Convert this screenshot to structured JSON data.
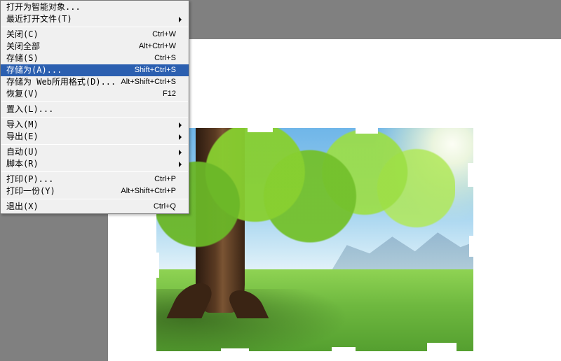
{
  "menu": {
    "items": [
      {
        "label": "打开为智能对象...",
        "shortcut": "",
        "submenu": false
      },
      {
        "label": "最近打开文件(T)",
        "shortcut": "",
        "submenu": true
      },
      {
        "sep": true
      },
      {
        "label": "关闭(C)",
        "shortcut": "Ctrl+W",
        "submenu": false
      },
      {
        "label": "关闭全部",
        "shortcut": "Alt+Ctrl+W",
        "submenu": false
      },
      {
        "label": "存储(S)",
        "shortcut": "Ctrl+S",
        "submenu": false
      },
      {
        "label": "存储为(A)...",
        "shortcut": "Shift+Ctrl+S",
        "submenu": false,
        "highlight": true
      },
      {
        "label": "存储为 Web所用格式(D)...",
        "shortcut": "Alt+Shift+Ctrl+S",
        "submenu": false
      },
      {
        "label": "恢复(V)",
        "shortcut": "F12",
        "submenu": false
      },
      {
        "sep": true
      },
      {
        "label": "置入(L)...",
        "shortcut": "",
        "submenu": false
      },
      {
        "sep": true
      },
      {
        "label": "导入(M)",
        "shortcut": "",
        "submenu": true
      },
      {
        "label": "导出(E)",
        "shortcut": "",
        "submenu": true
      },
      {
        "sep": true
      },
      {
        "label": "自动(U)",
        "shortcut": "",
        "submenu": true
      },
      {
        "label": "脚本(R)",
        "shortcut": "",
        "submenu": true
      },
      {
        "sep": true
      },
      {
        "label": "打印(P)...",
        "shortcut": "Ctrl+P",
        "submenu": false
      },
      {
        "label": "打印一份(Y)",
        "shortcut": "Alt+Shift+Ctrl+P",
        "submenu": false
      },
      {
        "sep": true
      },
      {
        "label": "退出(X)",
        "shortcut": "Ctrl+Q",
        "submenu": false
      }
    ]
  }
}
